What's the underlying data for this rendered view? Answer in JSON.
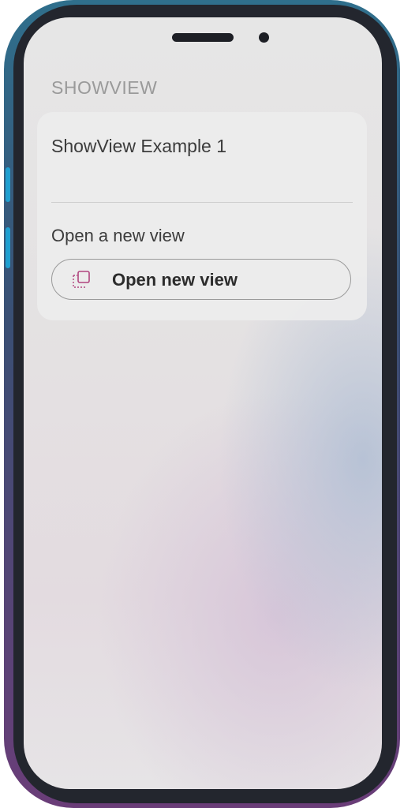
{
  "header": {
    "section_title": "SHOWVIEW"
  },
  "card": {
    "title": "ShowView Example 1",
    "action_label": "Open a new view",
    "button": {
      "label": "Open new view",
      "icon": "open-view-icon",
      "icon_color": "#b0457e"
    }
  }
}
